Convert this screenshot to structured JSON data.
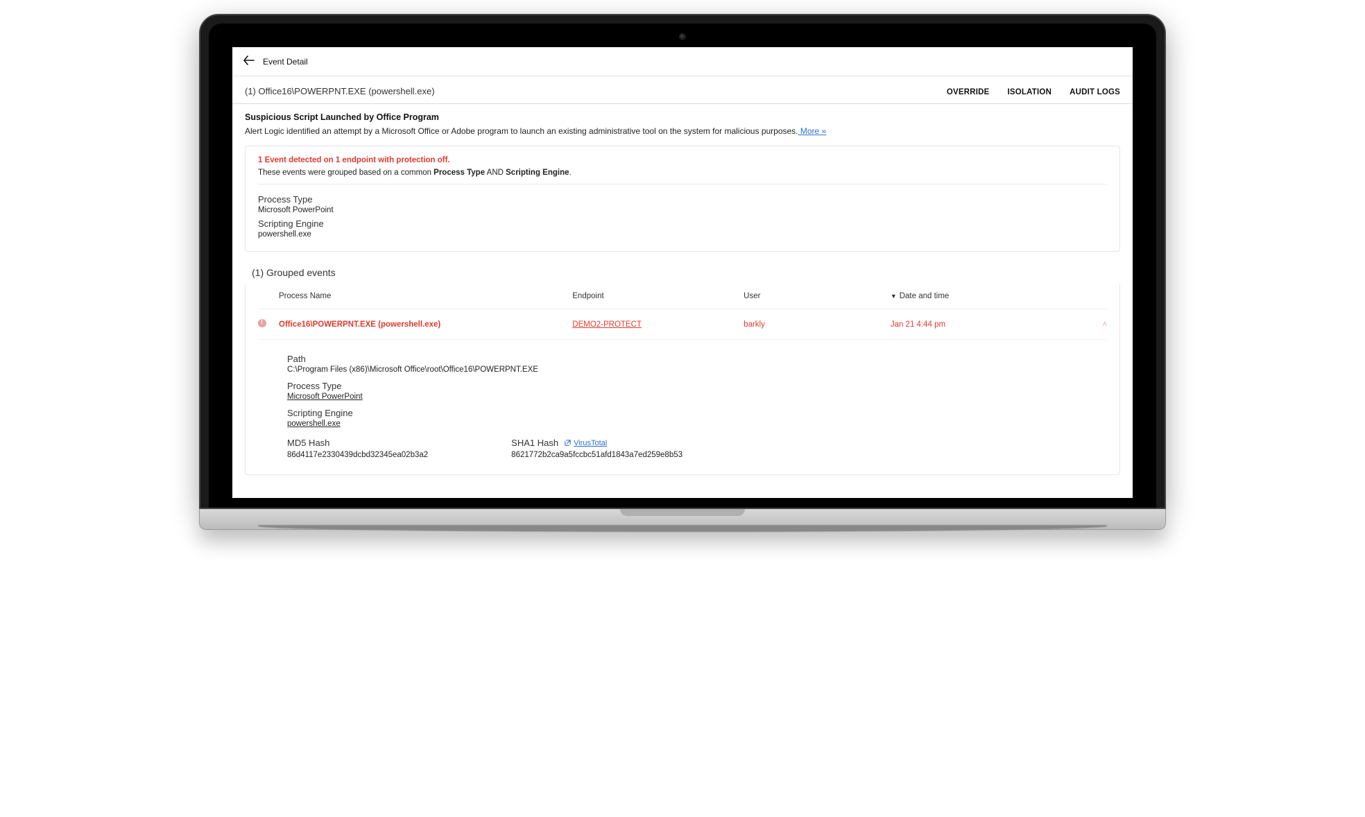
{
  "topbar": {
    "title": "Event Detail"
  },
  "subheader": {
    "title": "(1) Office16\\POWERPNT.EXE (powershell.exe)",
    "actions": {
      "override": "OVERRIDE",
      "isolation": "ISOLATION",
      "audit": "AUDIT LOGS"
    }
  },
  "alert": {
    "title": "Suspicious Script Launched by Office Program",
    "desc": "Alert Logic identified an attempt by a Microsoft Office or Adobe program to launch an existing administrative tool on the system for malicious purposes.",
    "more": " More »"
  },
  "summary": {
    "banner": "1 Event detected on 1 endpoint with protection off.",
    "sub_pre": "These events were grouped based on a common ",
    "sub_b1": "Process Type",
    "sub_mid": " AND ",
    "sub_b2": "Scripting Engine",
    "sub_post": ".",
    "process_type_label": "Process Type",
    "process_type_value": "Microsoft PowerPoint",
    "scripting_engine_label": "Scripting Engine",
    "scripting_engine_value": "powershell.exe"
  },
  "grouped": {
    "title": "(1) Grouped events",
    "columns": {
      "process": "Process Name",
      "endpoint": "Endpoint",
      "user": "User",
      "datetime": "Date and time"
    },
    "row": {
      "process": "Office16\\POWERPNT.EXE (powershell.exe)",
      "endpoint": "DEMO2-PROTECT",
      "user": "barkly",
      "datetime": "Jan 21 4:44 pm"
    },
    "details": {
      "path_label": "Path",
      "path_value": "C:\\Program Files (x86)\\Microsoft Office\\root\\Office16\\POWERPNT.EXE",
      "ptype_label": "Process Type",
      "ptype_value": "Microsoft PowerPoint",
      "seng_label": "Scripting Engine",
      "seng_value": "powershell.exe",
      "md5_label": "MD5 Hash",
      "md5_value": "86d4117e2330439dcbd32345ea02b3a2",
      "sha1_label": "SHA1 Hash",
      "sha1_value": "8621772b2ca9a5fccbc51afd1843a7ed259e8b53",
      "virustotal": "VirusTotal"
    }
  }
}
